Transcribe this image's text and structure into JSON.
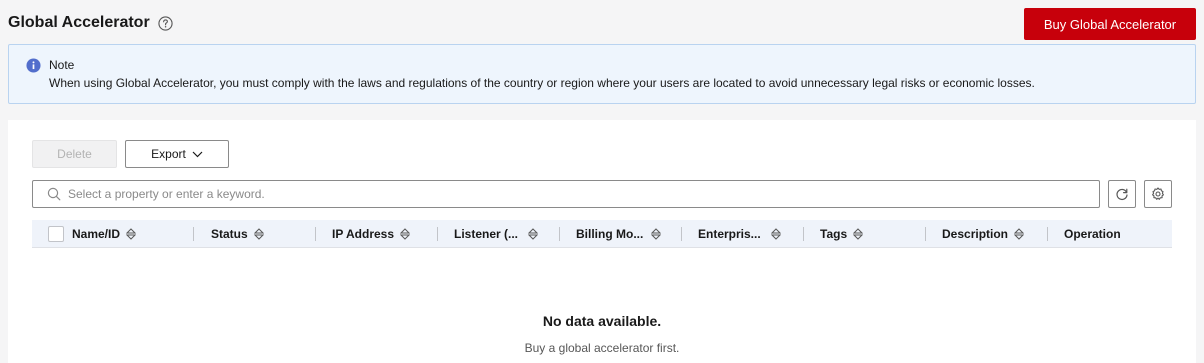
{
  "header": {
    "title": "Global Accelerator",
    "help_icon": "question-circle-icon",
    "buy_button_label": "Buy Global Accelerator"
  },
  "note": {
    "icon": "info-icon",
    "title": "Note",
    "body": "When using Global Accelerator, you must comply with the laws and regulations of the country or region where your users are located to avoid unnecessary legal risks or economic losses."
  },
  "toolbar": {
    "delete_label": "Delete",
    "export_label": "Export"
  },
  "search": {
    "placeholder": "Select a property or enter a keyword."
  },
  "table": {
    "columns": [
      {
        "label": "Name/ID",
        "sortable": true
      },
      {
        "label": "Status",
        "sortable": true
      },
      {
        "label": "IP Address",
        "sortable": true
      },
      {
        "label": "Listener (...",
        "sortable": true
      },
      {
        "label": "Billing Mo...",
        "sortable": true
      },
      {
        "label": "Enterpris...",
        "sortable": true
      },
      {
        "label": "Tags",
        "sortable": true
      },
      {
        "label": "Description",
        "sortable": true
      },
      {
        "label": "Operation",
        "sortable": false
      }
    ],
    "empty_title": "No data available.",
    "empty_description": "Buy a global accelerator first."
  },
  "colors": {
    "primary_red": "#c7000b",
    "info_blue": "#526ecc",
    "note_background": "#eef5fd"
  }
}
